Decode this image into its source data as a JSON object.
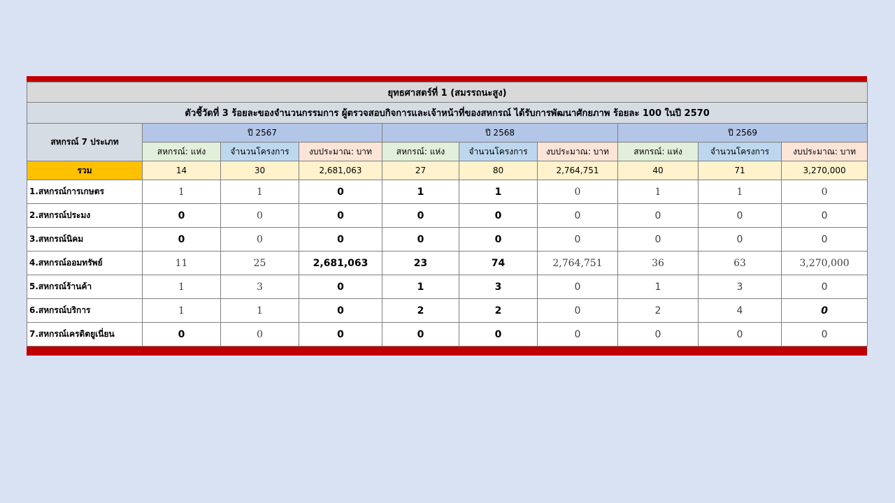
{
  "title": "ยุทธศาสตร์ที่ 1 (สมรรถนะสูง)",
  "indicator": "ตัวชี้วัดที่ 3 ร้อยละของจำนวนกรรมการ ผู้ตรวจสอบกิจการและเจ้าหน้าที่ของสหกรณ์ ได้รับการพัฒนาศักยภาพ ร้อยละ 100 ในปี 2570",
  "type_header": "สหกรณ์ 7 ประเภท",
  "years": [
    "ปี 2567",
    "ปี 2568",
    "ปี 2569"
  ],
  "sub_headers": [
    "สหกรณ์: แห่ง",
    "จำนวนโครงการ",
    "งบประมาณ: บาท"
  ],
  "total_label": "รวม",
  "totals": [
    "14",
    "30",
    "2,681,063",
    "27",
    "80",
    "2,764,751",
    "40",
    "71",
    "3,270,000"
  ],
  "rows": [
    {
      "label": "1.สหกรณ์การเกษตร",
      "cells": [
        "1",
        "1",
        "0",
        "1",
        "1",
        "0",
        "1",
        "1",
        "0"
      ]
    },
    {
      "label": "2.สหกรณ์ประมง",
      "cells": [
        "0",
        "0",
        "0",
        "0",
        "0",
        "0",
        "0",
        "0",
        "0"
      ]
    },
    {
      "label": "3.สหกรณ์นิคม",
      "cells": [
        "0",
        "0",
        "0",
        "0",
        "0",
        "0",
        "0",
        "0",
        "0"
      ]
    },
    {
      "label": "4.สหกรณ์ออมทรัพย์",
      "cells": [
        "11",
        "25",
        "2,681,063",
        "23",
        "74",
        "2,764,751",
        "36",
        "63",
        "3,270,000"
      ]
    },
    {
      "label": "5.สหกรณ์ร้านค้า",
      "cells": [
        "1",
        "3",
        "0",
        "1",
        "3",
        "0",
        "1",
        "3",
        "0"
      ]
    },
    {
      "label": "6.สหกรณ์บริการ",
      "cells": [
        "1",
        "1",
        "0",
        "2",
        "2",
        "0",
        "2",
        "4",
        "0"
      ]
    },
    {
      "label": "7.สหกรณ์เครดิตยูเนี่ยน",
      "cells": [
        "0",
        "0",
        "0",
        "0",
        "0",
        "0",
        "0",
        "0",
        "0"
      ]
    }
  ],
  "colors": {
    "background": "#d9e2f3",
    "accent_red": "#c00000",
    "total_highlight": "#ffc000",
    "year_header": "#b4c6e7"
  }
}
